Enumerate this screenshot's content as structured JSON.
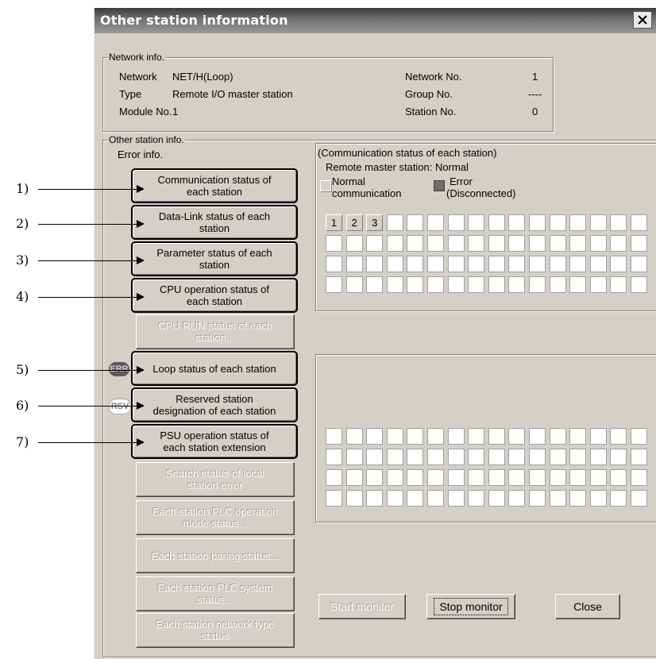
{
  "window": {
    "title": "Other station information"
  },
  "network_info": {
    "legend": "Network info.",
    "network_label": "Network",
    "network_value": "NET/H(Loop)",
    "type_label": "Type",
    "type_value": "Remote I/O master station",
    "module_label": "Module No.",
    "module_value": "1",
    "network_no_label": "Network No.",
    "network_no_value": "1",
    "group_no_label": "Group No.",
    "group_no_value": "----",
    "station_no_label": "Station No.",
    "station_no_value": "0"
  },
  "other_info": {
    "legend": "Other station info.",
    "error_info_label": "Error info.",
    "buttons": [
      {
        "line1": "Communication status of",
        "line2": "each station"
      },
      {
        "line1": "Data-Link status of each",
        "line2": "station"
      },
      {
        "line1": "Parameter status of each",
        "line2": "station"
      },
      {
        "line1": "CPU operation status of",
        "line2": "each station"
      },
      {
        "line1": "CPU RUN status of each",
        "line2": "station..."
      },
      {
        "line1": "Loop status of each station",
        "line2": ""
      },
      {
        "line1": "Reserved station",
        "line2": "designation of each station"
      },
      {
        "line1": "PSU operation status of",
        "line2": "each station extension"
      },
      {
        "line1": "Search status of local",
        "line2": "station error"
      },
      {
        "line1": "Each station PLC operation",
        "line2": "mode status..."
      },
      {
        "line1": "Each station paring status...",
        "line2": ""
      },
      {
        "line1": "Each station PLC system",
        "line2": "status..."
      },
      {
        "line1": "Each station network type",
        "line2": "status"
      }
    ],
    "badges": {
      "err": "ERR",
      "rsv": "RSV"
    }
  },
  "status_panel": {
    "heading": "(Communication status of each station)",
    "remote_master": "Remote master station: Normal",
    "legend_normal_1": "Normal",
    "legend_normal_2": "communication",
    "legend_error_1": "Error",
    "legend_error_2": "(Disconnected)",
    "station_numbers": [
      "1",
      "2",
      "3"
    ]
  },
  "footer": {
    "start_monitor": "Start monitor",
    "stop_monitor": "Stop monitor",
    "close": "Close"
  },
  "annotations": [
    "1)",
    "2)",
    "3)",
    "4)",
    "5)",
    "6)",
    "7)"
  ],
  "colors": {
    "dialog_bg": "#d4d0c8",
    "error_legend": "#6e6e6e",
    "title_text": "#ffffff"
  }
}
